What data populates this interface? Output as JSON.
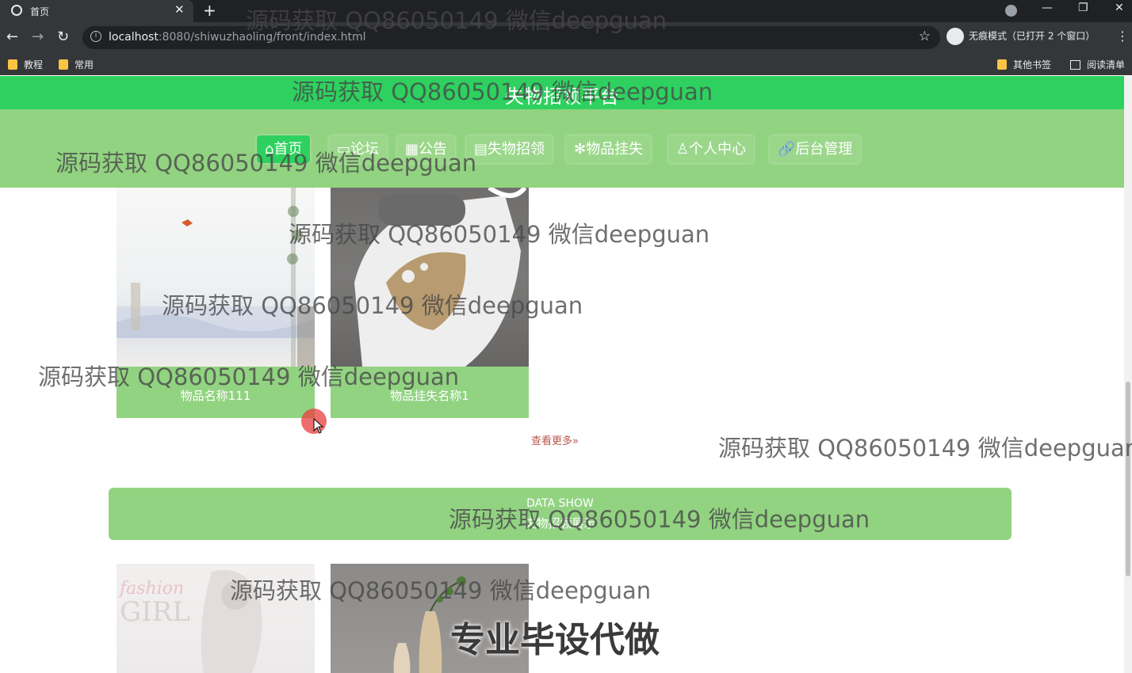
{
  "browser": {
    "tab_title": "首页",
    "url_host": "localhost",
    "url_rest": ":8080/shiwuzhaoling/front/index.html",
    "incognito_label": "无痕模式（已打开 2 个窗口）",
    "bookmarks": [
      "教程",
      "常用"
    ],
    "bookmarks_right": [
      "其他书签",
      "阅读清单"
    ]
  },
  "site": {
    "title": "失物招领平台",
    "nav": [
      {
        "label": "首页",
        "icon": "home-icon",
        "active": true
      },
      {
        "label": "论坛",
        "icon": "forum-icon"
      },
      {
        "label": "公告",
        "icon": "notice-icon"
      },
      {
        "label": "失物招领",
        "icon": "document-icon"
      },
      {
        "label": "物品挂失",
        "icon": "asterisk-icon"
      },
      {
        "label": "个人中心",
        "icon": "user-icon"
      },
      {
        "label": "后台管理",
        "icon": "link-icon"
      }
    ]
  },
  "section1": {
    "cards": [
      "物品名称111",
      "物品挂失名称1"
    ],
    "more_label": "查看更多"
  },
  "section2": {
    "title_en": "DATA SHOW",
    "title_cn": "失物招领展示"
  },
  "overlay": {
    "watermark": "源码获取 QQ86050149 微信deepguan",
    "promo": "专业毕设代做"
  },
  "colors": {
    "header_green": "#2ed15f",
    "nav_green": "#92d382",
    "more_link": "#b8564a"
  }
}
